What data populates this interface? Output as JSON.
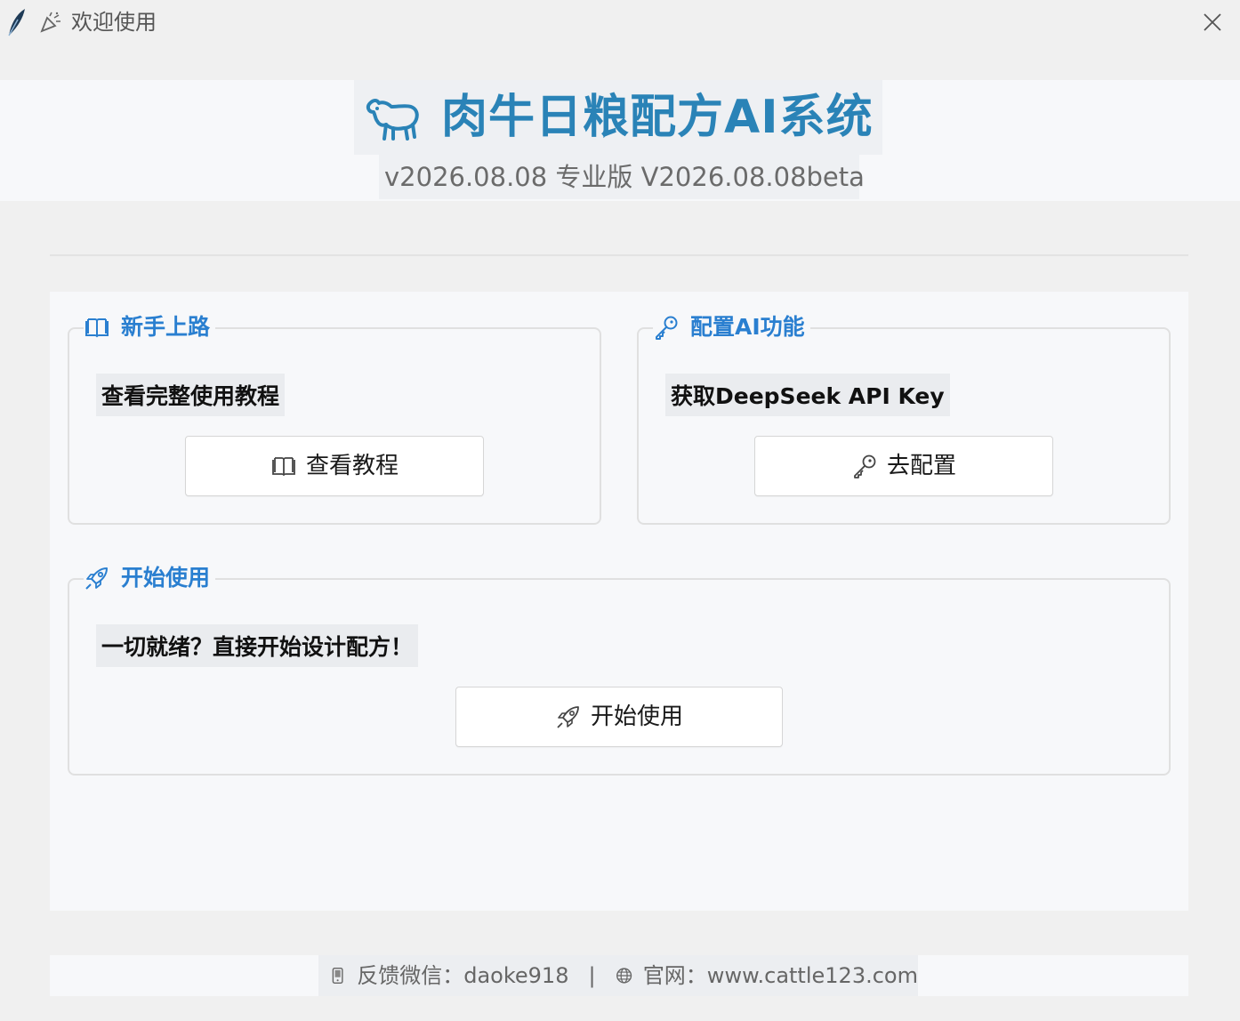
{
  "window": {
    "title": "欢迎使用"
  },
  "header": {
    "app_title": "肉牛日粮配方AI系统",
    "version": "v2026.08.08 专业版 V2026.08.08beta"
  },
  "groups": {
    "beginner": {
      "title": "新手上路",
      "icon": "book-icon",
      "description": "查看完整使用教程",
      "button_label": "查看教程",
      "button_icon": "book-icon"
    },
    "ai_config": {
      "title": "配置AI功能",
      "icon": "key-icon",
      "description": "获取DeepSeek API Key",
      "button_label": "去配置",
      "button_icon": "key-icon"
    },
    "start": {
      "title": "开始使用",
      "icon": "rocket-icon",
      "description": "一切就绪？直接开始设计配方！",
      "button_label": "开始使用",
      "button_icon": "rocket-icon"
    }
  },
  "footer": {
    "wechat": "反馈微信：daoke918",
    "separator": "|",
    "website": "官网：www.cattle123.com"
  },
  "colors": {
    "accent_title": "#2a83b7",
    "group_title": "#2a7fd0",
    "window_bg": "#f0f0f0",
    "panel_bg": "#f7f8fa"
  }
}
